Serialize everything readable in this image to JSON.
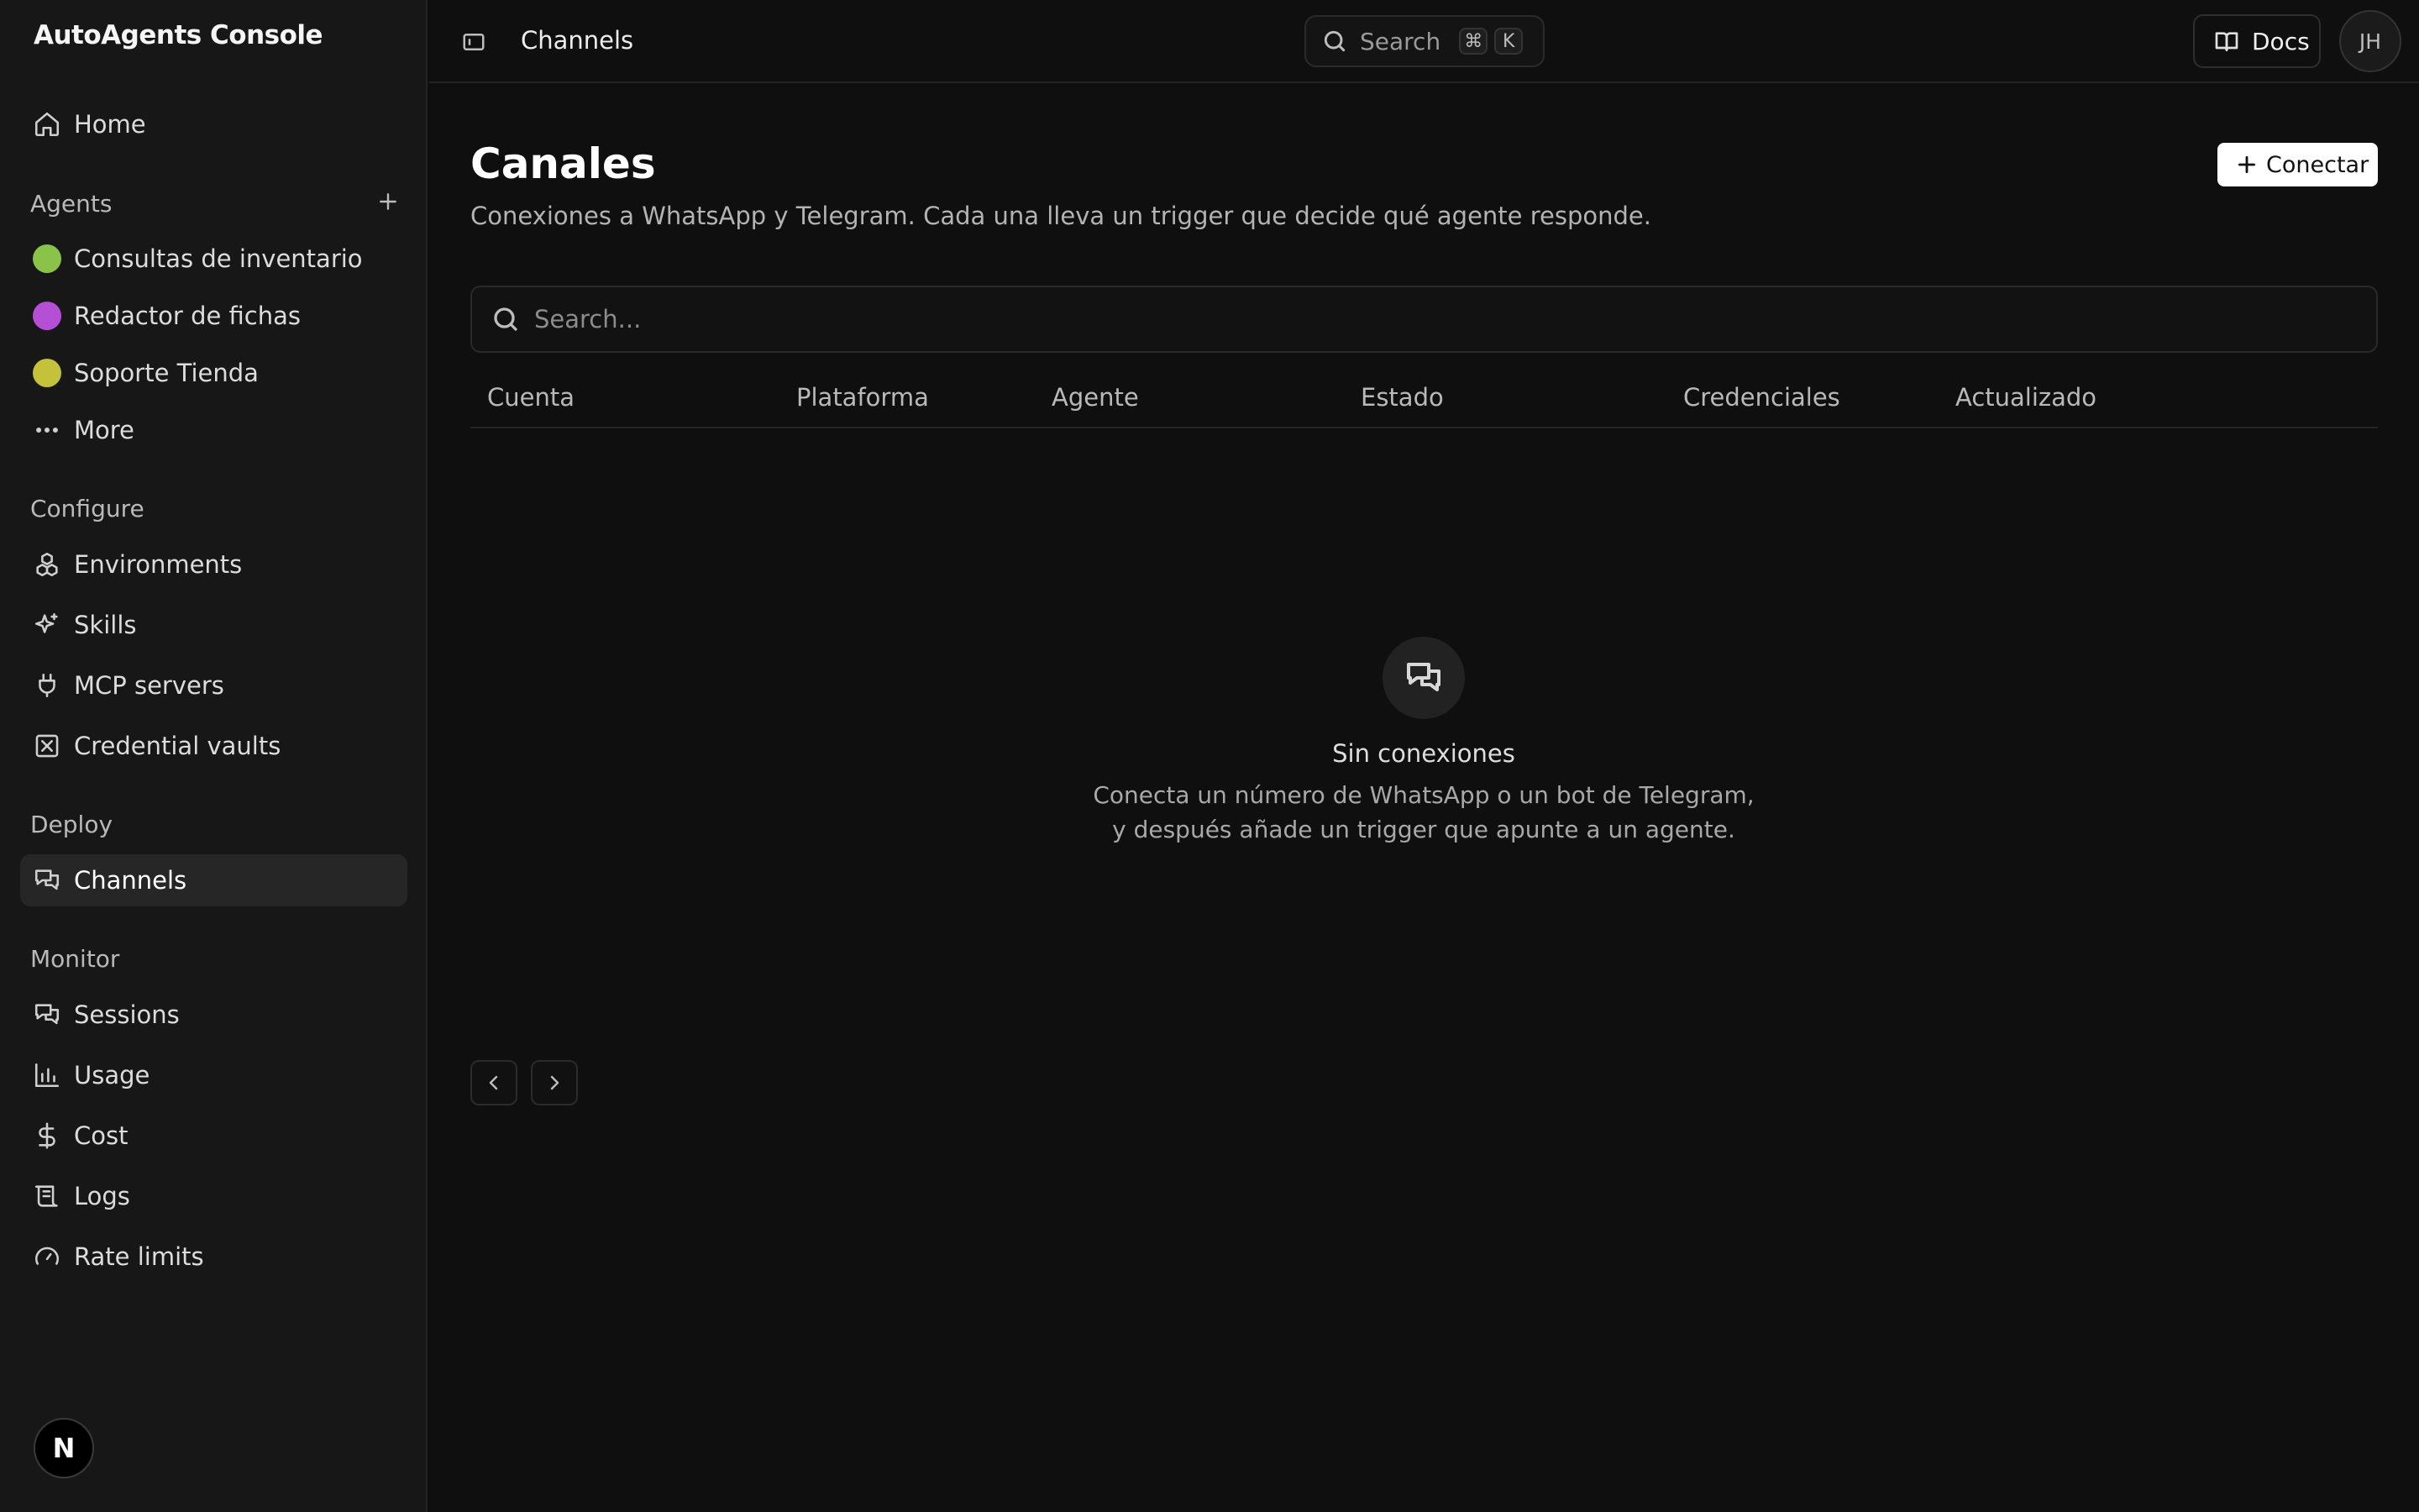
{
  "app": {
    "brand": "AutoAgents Console",
    "footer_avatar": "N"
  },
  "sidebar": {
    "home": {
      "label": "Home",
      "icon": "home-icon"
    },
    "agents_section": "Agents",
    "agents": [
      {
        "label": "Consultas de inventario",
        "color": "#8bc34a"
      },
      {
        "label": "Redactor de fichas",
        "color": "#b54fd6"
      },
      {
        "label": "Soporte Tienda",
        "color": "#c4c13a"
      }
    ],
    "more": {
      "label": "More",
      "icon": "more-icon"
    },
    "configure_section": "Configure",
    "configure": [
      {
        "label": "Environments",
        "icon": "boxes-icon"
      },
      {
        "label": "Skills",
        "icon": "sparkles-icon"
      },
      {
        "label": "MCP servers",
        "icon": "plug-icon"
      },
      {
        "label": "Credential vaults",
        "icon": "vault-icon"
      }
    ],
    "deploy_section": "Deploy",
    "deploy": [
      {
        "label": "Channels",
        "icon": "channels-icon",
        "active": true
      }
    ],
    "monitor_section": "Monitor",
    "monitor": [
      {
        "label": "Sessions",
        "icon": "sessions-icon"
      },
      {
        "label": "Usage",
        "icon": "chart-icon"
      },
      {
        "label": "Cost",
        "icon": "dollar-icon"
      },
      {
        "label": "Logs",
        "icon": "logs-icon"
      },
      {
        "label": "Rate limits",
        "icon": "gauge-icon"
      }
    ]
  },
  "topbar": {
    "breadcrumb": "Channels",
    "search_label": "Search",
    "shortcut_keys": [
      "⌘",
      "K"
    ],
    "docs_label": "Docs",
    "user_initials": "JH"
  },
  "main": {
    "title": "Canales",
    "subtitle": "Conexiones a WhatsApp y Telegram. Cada una lleva un trigger que decide qué agente responde.",
    "connect_label": "Conectar",
    "search_placeholder": "Search...",
    "columns": [
      "Cuenta",
      "Plataforma",
      "Agente",
      "Estado",
      "Credenciales",
      "Actualizado"
    ],
    "empty_title": "Sin conexiones",
    "empty_desc": "Conecta un número de WhatsApp o un bot de Telegram, y después añade un trigger que apunte a un agente."
  }
}
